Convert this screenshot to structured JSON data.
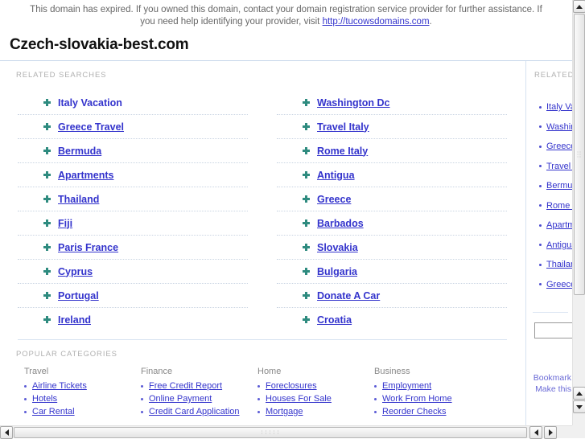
{
  "banner": {
    "text_before": "This domain has expired. If you owned this domain, contact your domain registration service provider for further assistance. If you need help identifying your provider, visit ",
    "link_text": "http://tucowsdomains.com",
    "text_after": "."
  },
  "header": {
    "domain_title": "Czech-slovakia-best.com"
  },
  "main": {
    "related_searches_label": "RELATED SEARCHES",
    "related_searches_left": [
      {
        "label": "Italy Vacation",
        "hovered": true
      },
      {
        "label": "Greece Travel",
        "hovered": false
      },
      {
        "label": "Bermuda",
        "hovered": false
      },
      {
        "label": "Apartments",
        "hovered": false
      },
      {
        "label": "Thailand",
        "hovered": false
      },
      {
        "label": "Fiji",
        "hovered": false
      },
      {
        "label": "Paris France",
        "hovered": false
      },
      {
        "label": "Cyprus",
        "hovered": false
      },
      {
        "label": "Portugal",
        "hovered": false
      },
      {
        "label": "Ireland",
        "hovered": false
      }
    ],
    "related_searches_right": [
      {
        "label": "Washington Dc",
        "hovered": false
      },
      {
        "label": "Travel Italy",
        "hovered": false
      },
      {
        "label": "Rome Italy",
        "hovered": false
      },
      {
        "label": "Antigua",
        "hovered": false
      },
      {
        "label": "Greece",
        "hovered": false
      },
      {
        "label": "Barbados",
        "hovered": false
      },
      {
        "label": "Slovakia",
        "hovered": false
      },
      {
        "label": "Bulgaria",
        "hovered": false
      },
      {
        "label": "Donate A Car",
        "hovered": false
      },
      {
        "label": "Croatia",
        "hovered": false
      }
    ],
    "popular_categories_label": "POPULAR CATEGORIES",
    "popular_categories": [
      {
        "heading": "Travel",
        "items": [
          "Airline Tickets",
          "Hotels",
          "Car Rental"
        ]
      },
      {
        "heading": "Finance",
        "items": [
          "Free Credit Report",
          "Online Payment",
          "Credit Card Application"
        ]
      },
      {
        "heading": "Home",
        "items": [
          "Foreclosures",
          "Houses For Sale",
          "Mortgage"
        ]
      },
      {
        "heading": "Business",
        "items": [
          "Employment",
          "Work From Home",
          "Reorder Checks"
        ]
      }
    ]
  },
  "sidebar": {
    "label": "RELATED",
    "items": [
      "Italy Vacation",
      "Washington Dc",
      "Greece Travel",
      "Travel Italy",
      "Bermuda",
      "Rome Italy",
      "Apartments",
      "Antigua",
      "Thailand",
      "Greece"
    ],
    "search_value": "",
    "search_placeholder": "",
    "footer_links": [
      "Bookmark",
      "Make this"
    ]
  },
  "colors": {
    "link": "#3333cc",
    "bullet": "#2e8b7f",
    "label": "#b0b0b0",
    "rule": "#d6e2f0"
  },
  "scrollbars": {
    "v_up": "▲",
    "v_down": "▼",
    "h_left": "◀",
    "h_right": "▶"
  }
}
